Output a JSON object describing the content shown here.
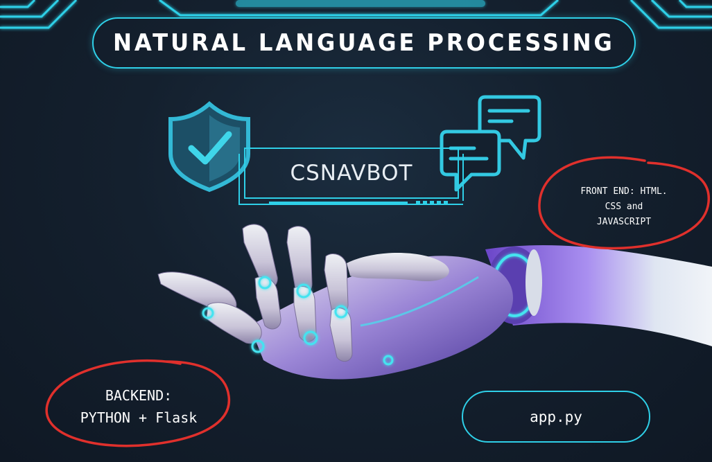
{
  "title": "NATURAL LANGUAGE PROCESSING",
  "bot_name": "CSNAVBOT",
  "notes": {
    "frontend": [
      "FRONT END: HTML.",
      "CSS and",
      "JAVASCRIPT"
    ],
    "backend": [
      "BACKEND:",
      "PYTHON + Flask"
    ]
  },
  "file_label": "app.py",
  "icons": [
    "shield-check-icon",
    "chat-bubbles-icon",
    "robot-hand-image"
  ],
  "colors": {
    "accent": "#2fd0e8",
    "circle": "#e0302c",
    "background": "#14202e"
  }
}
